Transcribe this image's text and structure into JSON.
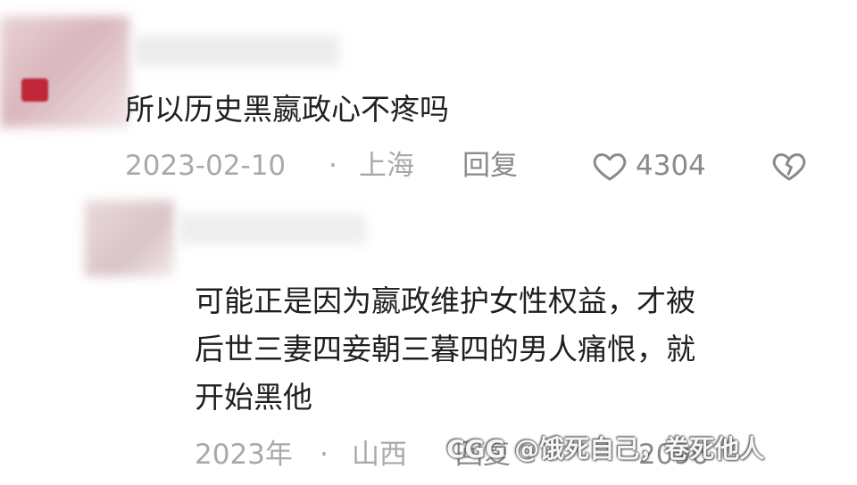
{
  "comments": [
    {
      "text": "所以历史黑嬴政心不疼吗",
      "date": "2023-02-10",
      "separator": "·",
      "location": "上海",
      "reply_label": "回复",
      "likes": "4304"
    },
    {
      "lines": [
        "可能正是因为嬴政维护女性权益，才被",
        "后世三妻四妾朝三暮四的男人痛恨，就",
        "开始黑他"
      ],
      "date": "2023年",
      "separator": "·",
      "location": "山西",
      "reply_label": "回复",
      "likes": "2096"
    }
  ],
  "watermark": "CGG @饿死自己，卷死他人",
  "icons": {
    "like": "heart-outline-icon",
    "dislike": "broken-heart-icon"
  },
  "colors": {
    "text": "#1f1f1f",
    "meta": "#a9a9a9",
    "action": "#8a8a8a"
  }
}
